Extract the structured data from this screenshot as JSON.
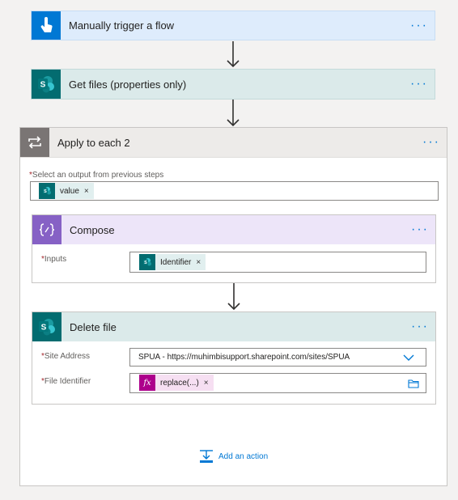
{
  "trigger": {
    "title": "Manually trigger a flow",
    "icon": "touch-hand-icon",
    "color": "#0078d4"
  },
  "get_files": {
    "title": "Get files (properties only)",
    "icon": "sharepoint-icon",
    "color": "#036c70"
  },
  "apply_each": {
    "title": "Apply to each 2",
    "icon": "loop-icon",
    "select_label": "Select an output from previous steps",
    "select_token": "value"
  },
  "compose": {
    "title": "Compose",
    "icon": "code-braces-icon",
    "color": "#8661c5",
    "inputs_label": "Inputs",
    "inputs_token": "Identifier"
  },
  "delete_file": {
    "title": "Delete file",
    "icon": "sharepoint-icon",
    "site_label": "Site Address",
    "site_value": "SPUA - https://muhimbisupport.sharepoint.com/sites/SPUA",
    "file_label": "File Identifier",
    "file_token": "replace(...)"
  },
  "add_action": {
    "label": "Add an action",
    "icon": "add-action-icon"
  },
  "required_mark": "*",
  "remove_mark": "×",
  "more_glyph": "···"
}
